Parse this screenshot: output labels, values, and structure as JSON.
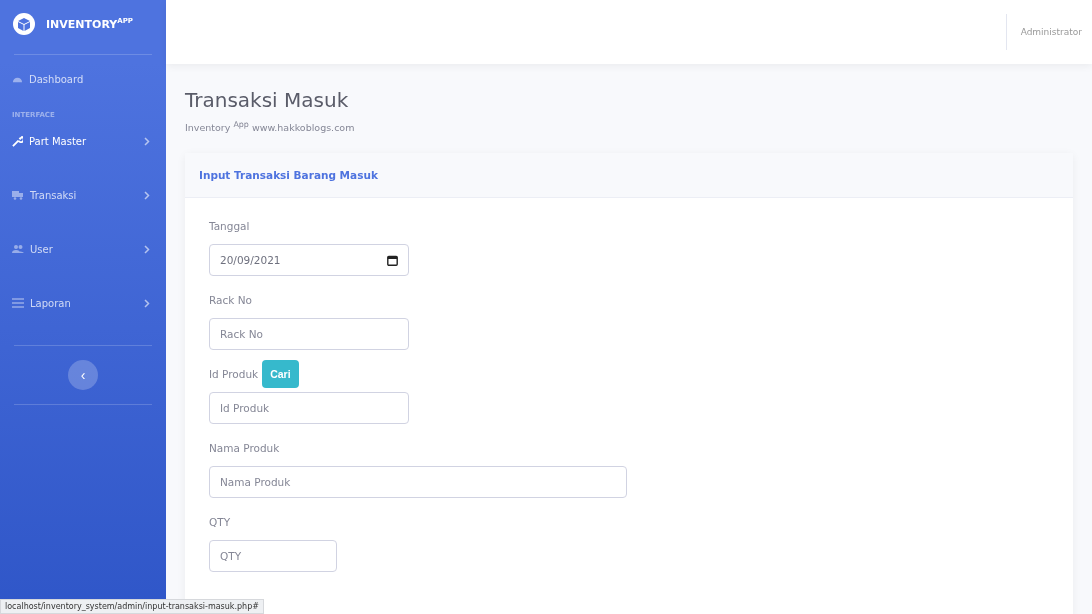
{
  "brand": {
    "name": "INVENTORY",
    "sup": "APP"
  },
  "sidebar": {
    "items": [
      {
        "kind": "link",
        "label": "Dashboard"
      },
      {
        "kind": "heading",
        "label": "INTERFACE"
      },
      {
        "kind": "menu",
        "label": "Part Master"
      },
      {
        "kind": "menu",
        "label": "Transaksi"
      },
      {
        "kind": "menu",
        "label": "User"
      },
      {
        "kind": "menu",
        "label": "Laporan"
      }
    ],
    "toggle": "‹"
  },
  "topbar": {
    "user": "Administrator"
  },
  "page": {
    "title": "Transaksi Masuk",
    "subtitle": "Inventory $^{App}$ www.hakkoblogs.com"
  },
  "card": {
    "header": "Input Transaksi Barang Masuk",
    "fields": [
      {
        "kind": "date",
        "label": "Tanggal",
        "value": "20/09/2021"
      },
      {
        "kind": "text",
        "label": "Rack No",
        "placeholder": "Rack No"
      },
      {
        "kind": "text",
        "label": "Id Produk",
        "button": "Cari",
        "placeholder": "Id Produk"
      },
      {
        "kind": "text",
        "label": "Nama Produk",
        "placeholder": "Nama Produk"
      },
      {
        "kind": "text",
        "label": "QTY",
        "placeholder": "QTY"
      }
    ]
  },
  "status_bar": {
    "url": "localhost/inventory_system/admin/input-transaksi-masuk.php#"
  }
}
